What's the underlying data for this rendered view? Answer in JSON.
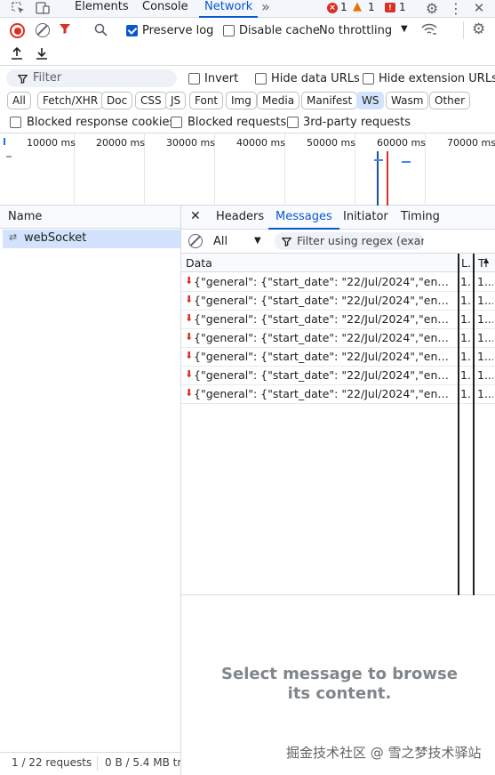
{
  "topbar": {
    "tabs": [
      {
        "label": "Elements",
        "active": false
      },
      {
        "label": "Console",
        "active": false
      },
      {
        "label": "Network",
        "active": true
      }
    ],
    "more_icon": "chevrons-right-icon",
    "errors_count": "1",
    "warnings_count": "1",
    "issues_count": "1"
  },
  "toolbar": {
    "preserve_log_label": "Preserve log",
    "preserve_log_checked": true,
    "disable_cache_label": "Disable cache",
    "disable_cache_checked": false,
    "throttling_value": "No throttling"
  },
  "filters": {
    "filter_placeholder": "Filter",
    "invert_label": "Invert",
    "hide_data_urls_label": "Hide data URLs",
    "hide_extension_urls_label": "Hide extension URLs",
    "types": [
      "All",
      "Fetch/XHR",
      "Doc",
      "CSS",
      "JS",
      "Font",
      "Img",
      "Media",
      "Manifest",
      "WS",
      "Wasm",
      "Other"
    ],
    "active_type": "WS",
    "blocked_response_cookies_label": "Blocked response cookies",
    "blocked_requests_label": "Blocked requests",
    "third_party_label": "3rd-party requests"
  },
  "timeline": {
    "labels": [
      "10000 ms",
      "20000 ms",
      "30000 ms",
      "40000 ms",
      "50000 ms",
      "60000 ms",
      "70000 ms"
    ]
  },
  "requests": {
    "header": "Name",
    "items": [
      {
        "name": "webSocket",
        "selected": true
      }
    ],
    "status": "1 / 22 requests",
    "transfer": "0 B / 5.4 MB tr"
  },
  "detail": {
    "tabs": [
      "Headers",
      "Messages",
      "Initiator",
      "Timing"
    ],
    "active_tab": "Messages",
    "message_filter_value": "All",
    "regex_placeholder": "Filter using regex (examp",
    "columns": {
      "data": "Data",
      "length": "L.",
      "time": "Ti"
    },
    "messages": [
      {
        "data": "{\"general\": {\"start_date\": \"22/Jul/2024\",\"end_date\": \"",
        "length": "1..",
        "time": "1..."
      },
      {
        "data": "{\"general\": {\"start_date\": \"22/Jul/2024\",\"end_date\": \"",
        "length": "1..",
        "time": "1..."
      },
      {
        "data": "{\"general\": {\"start_date\": \"22/Jul/2024\",\"end_date\": \"",
        "length": "1..",
        "time": "1..."
      },
      {
        "data": "{\"general\": {\"start_date\": \"22/Jul/2024\",\"end_date\": \"",
        "length": "1..",
        "time": "1..."
      },
      {
        "data": "{\"general\": {\"start_date\": \"22/Jul/2024\",\"end_date\": \"",
        "length": "1..",
        "time": "1..."
      },
      {
        "data": "{\"general\": {\"start_date\": \"22/Jul/2024\",\"end_date\": \"",
        "length": "1..",
        "time": "1..."
      },
      {
        "data": "{\"general\": {\"start_date\": \"22/Jul/2024\",\"end_date\": \"",
        "length": "1..",
        "time": "1..."
      }
    ],
    "empty_message": "Select message to browse its content."
  },
  "watermark": "掘金技术社区 @ 雪之梦技术驿站",
  "colors": {
    "accent": "#0b57d0",
    "record": "#d93025",
    "warning": "#e37400",
    "selected_bg": "#d3e3fd"
  }
}
